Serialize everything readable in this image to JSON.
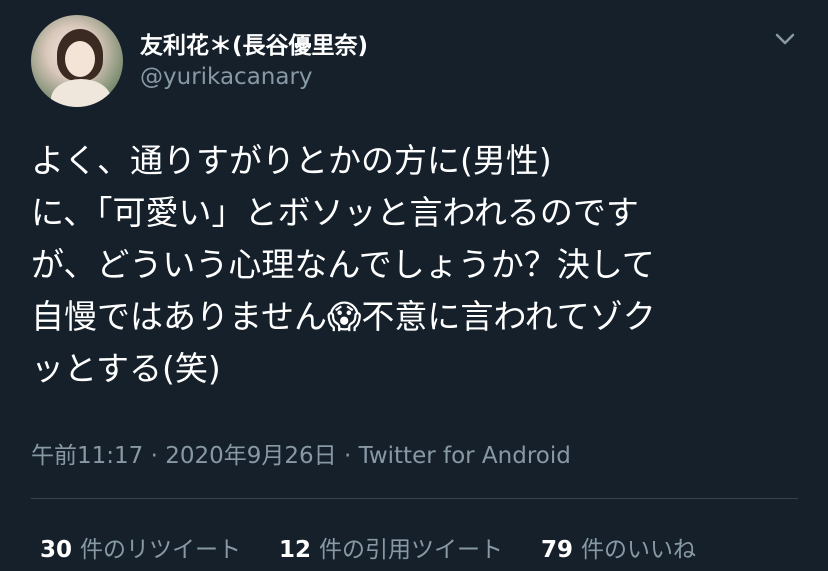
{
  "author": {
    "display_name": "友利花＊(長谷優里奈)",
    "handle": "@yurikacanary"
  },
  "tweet": {
    "text": "よく、通りすがりとかの方に(男性)\nに、「可愛い」とボソッと言われるのです\nが、どういう心理なんでしょうか？決して\n自慢ではありません😱不意に言われてゾク\nッとする(笑)",
    "timestamp": "午前11:17 · 2020年9月26日",
    "separator": " · ",
    "source": "Twitter for Android"
  },
  "stats": {
    "retweets": {
      "count": "30",
      "label": "件のリツイート"
    },
    "quotes": {
      "count": "12",
      "label": "件の引用ツイート"
    },
    "likes": {
      "count": "79",
      "label": "件のいいね"
    }
  },
  "icons": {
    "more": "chevron-down-icon",
    "avatar": "avatar"
  },
  "colors": {
    "background": "#15202b",
    "primary_text": "#ffffff",
    "secondary_text": "#8899a6",
    "divider": "#38444d"
  }
}
